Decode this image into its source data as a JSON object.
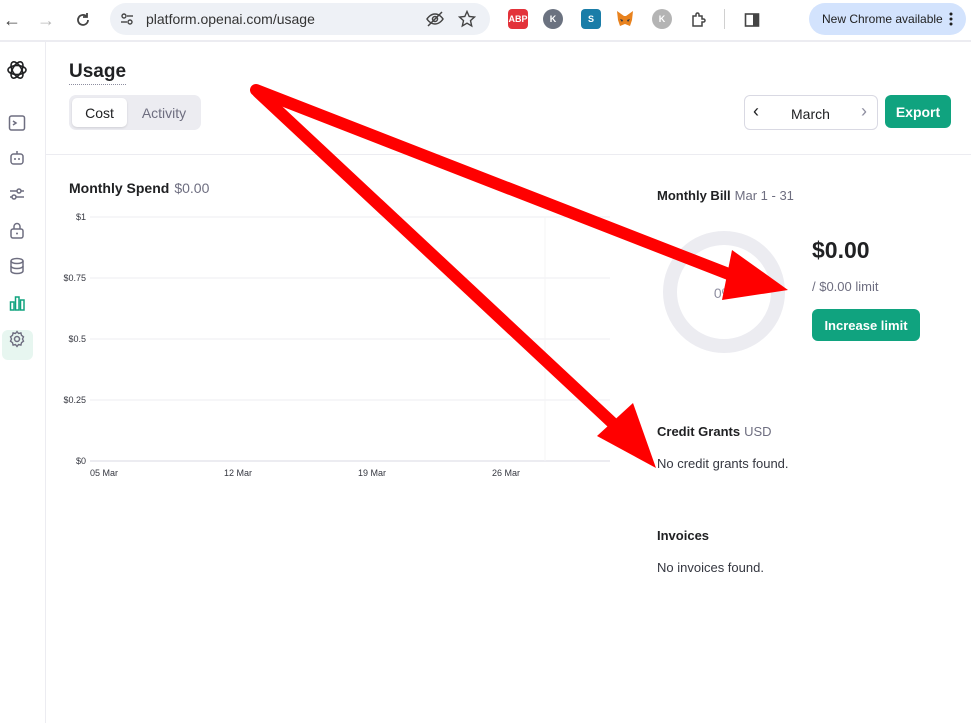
{
  "browser": {
    "url": "platform.openai.com/usage",
    "update_label": "New Chrome available",
    "extensions": [
      {
        "name": "abp",
        "label": "ABP",
        "color": "#e3323a"
      },
      {
        "name": "kami",
        "label": "K",
        "color": "#6b7280"
      },
      {
        "name": "s-ext",
        "label": "S",
        "color": "#1a7da8"
      },
      {
        "name": "metamask",
        "label": "",
        "color": "#e8821e"
      },
      {
        "name": "k-ext",
        "label": "K",
        "color": "#b4b4b4"
      }
    ]
  },
  "page": {
    "title": "Usage",
    "tabs": [
      {
        "label": "Cost",
        "active": true
      },
      {
        "label": "Activity",
        "active": false
      }
    ],
    "month": "March",
    "export_label": "Export"
  },
  "spend": {
    "title": "Monthly Spend",
    "value": "$0.00"
  },
  "chart_data": {
    "type": "bar",
    "title": "Monthly Spend",
    "categories": [
      "05 Mar",
      "12 Mar",
      "19 Mar",
      "26 Mar"
    ],
    "y_tick_labels": [
      "$1",
      "$0.75",
      "$0.5",
      "$0.25",
      "$0"
    ],
    "y_ticks": [
      1,
      0.75,
      0.5,
      0.25,
      0
    ],
    "ylim": [
      0,
      1
    ],
    "values": [
      0,
      0,
      0,
      0
    ],
    "grid": true
  },
  "bill": {
    "title": "Monthly Bill",
    "range": "Mar 1 - 31",
    "percent_label": "0%",
    "percent": 0,
    "amount": "$0.00",
    "limit": "/ $0.00 limit",
    "increase_label": "Increase limit"
  },
  "credit": {
    "title": "Credit Grants",
    "currency": "USD",
    "empty": "No credit grants found."
  },
  "invoices": {
    "title": "Invoices",
    "empty": "No invoices found."
  },
  "colors": {
    "accent": "#10a37f",
    "annotation": "#ff0000",
    "donut_track": "#ececf1"
  }
}
